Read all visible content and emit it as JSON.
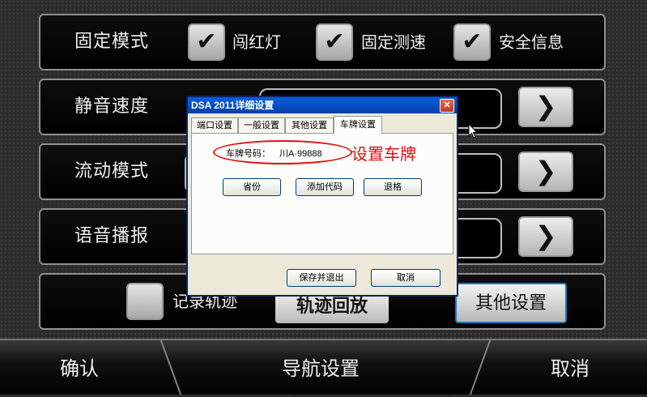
{
  "rows": {
    "fixed_mode": {
      "label": "固定模式",
      "check1": {
        "checked": true,
        "label": "闯红灯"
      },
      "check2": {
        "checked": true,
        "label": "固定测速"
      },
      "check3": {
        "checked": true,
        "label": "安全信息"
      }
    },
    "mute_speed": {
      "label": "静音速度"
    },
    "mobile_mode": {
      "label": "流动模式"
    },
    "voice": {
      "label": "语音播报"
    },
    "bottom_row": {
      "record_track": {
        "checked": false,
        "label": "记录轨迹"
      },
      "playback_label": "轨迹回放",
      "other_settings_label": "其他设置"
    }
  },
  "icons": {
    "check": "✔",
    "arrow": "❯"
  },
  "bottom_bar": {
    "confirm": "确认",
    "navigation": "导航设置",
    "cancel": "取消"
  },
  "dialog": {
    "title": "DSA 2011详细设置",
    "close": "✕",
    "tabs": [
      "端口设置",
      "一般设置",
      "其他设置",
      "车牌设置"
    ],
    "active_tab": "车牌设置",
    "plate_label": "车牌号码：",
    "plate_value": "川A·99888",
    "buttons": {
      "province": "省份",
      "add_code": "添加代码",
      "backspace": "退格"
    },
    "footer": {
      "save_exit": "保存并退出",
      "cancel": "取消"
    }
  },
  "annotation": "设置车牌",
  "colors": {
    "annotation": "#e01010",
    "titlebar": "#0a5fd8"
  }
}
